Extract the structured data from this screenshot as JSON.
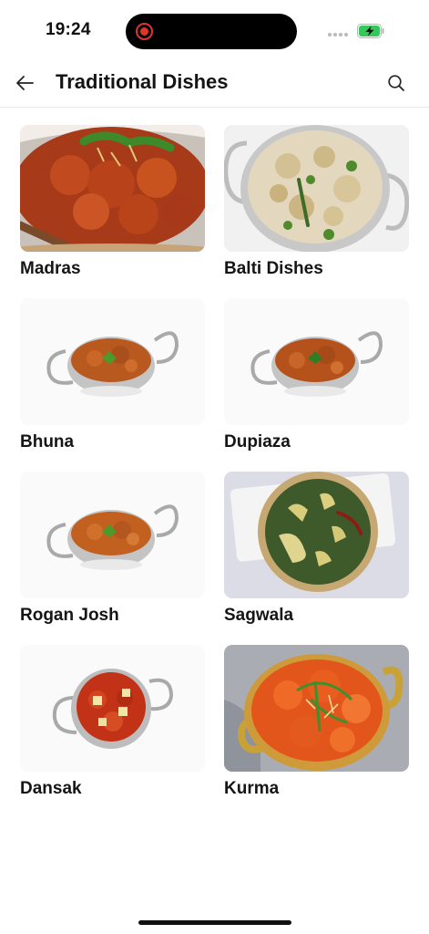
{
  "status_bar": {
    "time": "19:24",
    "recording_icon": "screen-recording-icon",
    "battery_icon": "battery-charging-icon",
    "battery_color": "#34c759"
  },
  "header": {
    "title": "Traditional Dishes",
    "back_icon": "arrow-left-icon",
    "search_icon": "search-icon"
  },
  "dishes": [
    {
      "name": "Madras",
      "style": "closeup-red"
    },
    {
      "name": "Balti Dishes",
      "style": "closeup-creamy"
    },
    {
      "name": "Bhuna",
      "style": "bowl-white"
    },
    {
      "name": "Dupiaza",
      "style": "bowl-white"
    },
    {
      "name": "Rogan Josh",
      "style": "bowl-white"
    },
    {
      "name": "Sagwala",
      "style": "green-plate"
    },
    {
      "name": "Dansak",
      "style": "bowl-red-white"
    },
    {
      "name": "Kurma",
      "style": "closeup-orange-grey"
    }
  ],
  "colors": {
    "accent_text": "#151515",
    "divider": "#e9e9e9",
    "recording_red": "#e0352b"
  }
}
